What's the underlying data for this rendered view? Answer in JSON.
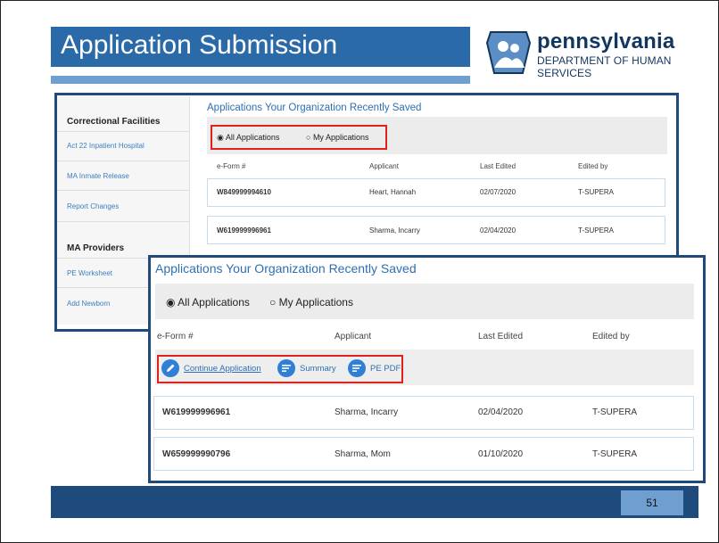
{
  "header": {
    "title": "Application Submission",
    "logo_word": "pennsylvania",
    "logo_dept": "DEPARTMENT OF HUMAN SERVICES"
  },
  "sidebar": {
    "sections": [
      {
        "heading": "Correctional Facilities",
        "links": [
          "Act 22 Inpatient Hospital",
          "MA Inmate Release",
          "Report Changes"
        ]
      },
      {
        "heading": "MA Providers",
        "links": [
          "PE Worksheet",
          "Add Newborn"
        ]
      }
    ]
  },
  "back_panel": {
    "title": "Applications Your Organization Recently Saved",
    "radio_all": "All Applications",
    "radio_mine": "My Applications",
    "columns": [
      "e-Form #",
      "Applicant",
      "Last Edited",
      "Edited by"
    ],
    "rows": [
      [
        "W849999994610",
        "Heart, Hannah",
        "02/07/2020",
        "T-SUPERA"
      ],
      [
        "W619999996961",
        "Sharma, Incarry",
        "02/04/2020",
        "T-SUPERA"
      ]
    ]
  },
  "front_panel": {
    "title": "Applications Your Organization Recently Saved",
    "radio_all": "All Applications",
    "radio_mine": "My Applications",
    "columns": [
      "e-Form #",
      "Applicant",
      "Last Edited",
      "Edited by"
    ],
    "actions": {
      "continue": "Continue Application",
      "summary": "Summary",
      "pdf": "PE PDF"
    },
    "rows": [
      [
        "W619999996961",
        "Sharma, Incarry",
        "02/04/2020",
        "T-SUPERA"
      ],
      [
        "W659999990796",
        "Sharma, Mom",
        "01/10/2020",
        "T-SUPERA"
      ]
    ]
  },
  "footer": {
    "page_number": "51"
  },
  "colors": {
    "brand_blue": "#1f4a7c",
    "accent_blue": "#2f7fd6",
    "highlight_red": "#e0211c"
  }
}
